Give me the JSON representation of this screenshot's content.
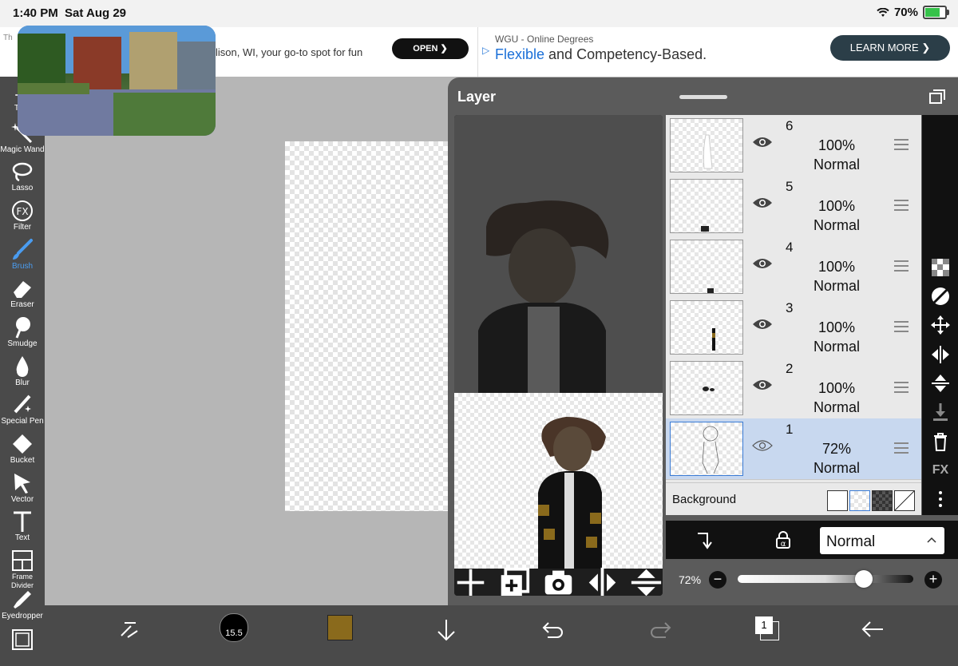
{
  "status": {
    "time": "1:40 PM",
    "date": "Sat Aug 29",
    "battery": "70%"
  },
  "ads": {
    "left_label": "Th",
    "left_text": "lison, WI, your go-to spot for fun",
    "left_button": "OPEN",
    "right_sponsor": "WGU - Online Degrees",
    "right_highlight": "Flexible",
    "right_text": " and Competency-Based.",
    "right_button": "LEARN MORE"
  },
  "toolbar": {
    "items": [
      {
        "label": "Tran",
        "icon": "transform-icon"
      },
      {
        "label": "Magic Wand",
        "icon": "magic-wand-icon"
      },
      {
        "label": "Lasso",
        "icon": "lasso-icon"
      },
      {
        "label": "Filter",
        "icon": "filter-fx-icon"
      },
      {
        "label": "Brush",
        "icon": "brush-icon"
      },
      {
        "label": "Eraser",
        "icon": "eraser-icon"
      },
      {
        "label": "Smudge",
        "icon": "smudge-icon"
      },
      {
        "label": "Blur",
        "icon": "blur-icon"
      },
      {
        "label": "Special Pen",
        "icon": "special-pen-icon"
      },
      {
        "label": "Bucket",
        "icon": "bucket-icon"
      },
      {
        "label": "Vector",
        "icon": "vector-icon"
      },
      {
        "label": "Text",
        "icon": "text-icon"
      },
      {
        "label": "Frame Divider",
        "icon": "frame-divider-icon"
      },
      {
        "label": "Eyedropper",
        "icon": "eyedropper-icon"
      }
    ],
    "active": "Brush"
  },
  "bottom": {
    "brush_size": "15.5",
    "color": "#8a6a1c",
    "layer_count": "1"
  },
  "layer_panel": {
    "title": "Layer",
    "layers": [
      {
        "num": "6",
        "opacity": "100%",
        "mode": "Normal"
      },
      {
        "num": "5",
        "opacity": "100%",
        "mode": "Normal"
      },
      {
        "num": "4",
        "opacity": "100%",
        "mode": "Normal"
      },
      {
        "num": "3",
        "opacity": "100%",
        "mode": "Normal"
      },
      {
        "num": "2",
        "opacity": "100%",
        "mode": "Normal"
      },
      {
        "num": "1",
        "opacity": "72%",
        "mode": "Normal"
      }
    ],
    "selected_layer": "1",
    "background_label": "Background",
    "blend_mode": "Normal",
    "opacity": "72%",
    "opacity_value": 0.72,
    "side_fx_label": "FX"
  }
}
